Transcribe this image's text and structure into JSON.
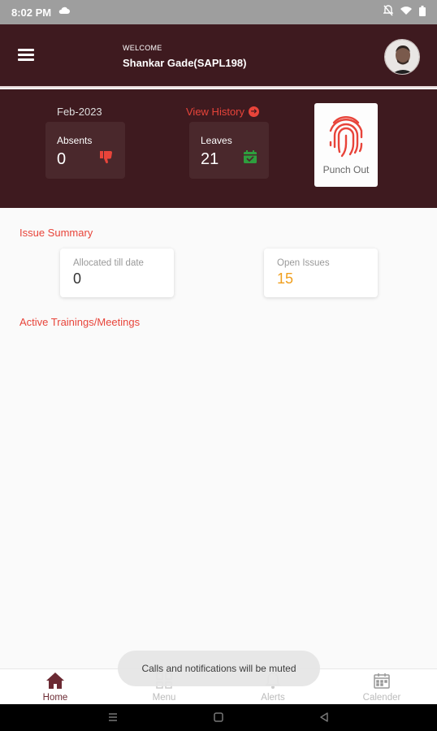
{
  "status_bar": {
    "time": "8:02 PM"
  },
  "header": {
    "welcome": "WELCOME",
    "username": "Shankar Gade(SAPL198)"
  },
  "summary": {
    "month": "Feb-2023",
    "view_history": "View History",
    "absents": {
      "label": "Absents",
      "value": "0"
    },
    "leaves": {
      "label": "Leaves",
      "value": "21"
    },
    "punch_label": "Punch Out"
  },
  "issues": {
    "title": "Issue Summary",
    "allocated": {
      "label": "Allocated till date",
      "value": "0"
    },
    "open": {
      "label": "Open Issues",
      "value": "15"
    }
  },
  "trainings": {
    "title": "Active Trainings/Meetings"
  },
  "toast": "Calls and notifications will be muted",
  "nav": {
    "home": "Home",
    "menu": "Menu",
    "alerts": "Alerts",
    "calendar": "Calender"
  },
  "colors": {
    "header_bg": "#3e1a1f",
    "accent": "#e8443a",
    "open_issues": "#f0a020",
    "leaves_icon": "#2e9e3e"
  },
  "icons": [
    "cloud-icon",
    "bell-off-icon",
    "wifi-icon",
    "battery-icon",
    "thumbs-down-icon",
    "calendar-check-icon",
    "fingerprint-icon",
    "home-icon",
    "grid-menu-icon",
    "bell-icon",
    "calendar-icon"
  ]
}
